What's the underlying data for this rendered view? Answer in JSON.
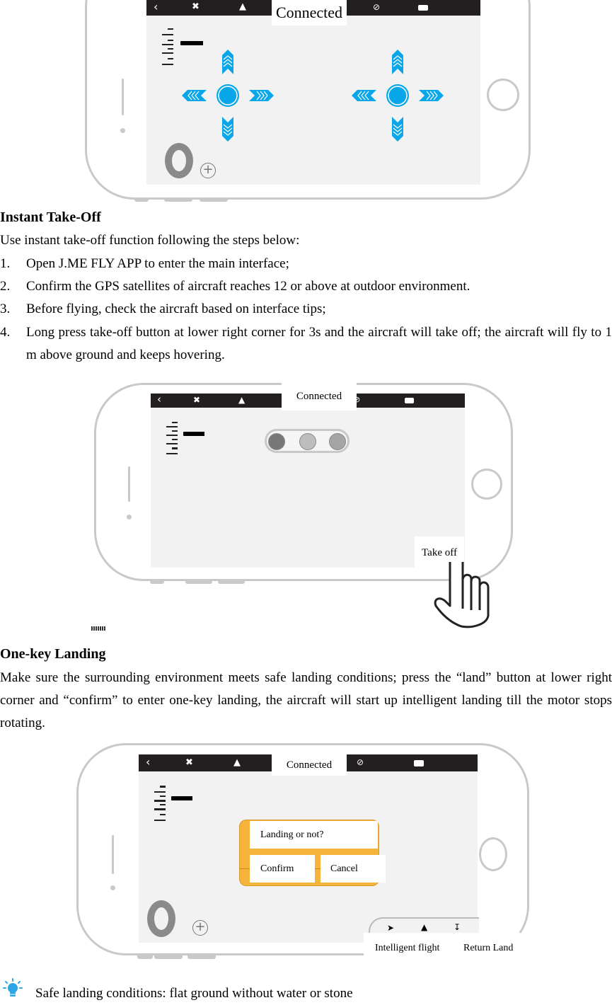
{
  "app_screens": [
    {
      "id": "main-interface",
      "status_label": "Connected",
      "topbar_icons": [
        "back-icon",
        "satellite-icon",
        "takeoff-icon",
        "compass-icon",
        "battery-icon"
      ]
    },
    {
      "id": "takeoff-interface",
      "status_label": "Connected",
      "topbar_icons": [
        "back-icon",
        "satellite-icon",
        "takeoff-icon",
        "compass-icon",
        "battery-icon"
      ],
      "indicator_lights": [
        "#777777",
        "#bdbdbd",
        "#a5a5a5"
      ],
      "takeoff_label": "Take off"
    },
    {
      "id": "landing-interface",
      "status_label": "Connected",
      "topbar_icons": [
        "back-icon",
        "satellite-icon",
        "takeoff-icon",
        "compass-icon",
        "battery-icon"
      ],
      "dialog": {
        "question": "Landing or not?",
        "confirm_label": "Confirm",
        "cancel_label": "Cancel",
        "color": "#f6b33c"
      },
      "mode_labels": {
        "intelligent_flight": "Intelligent flight",
        "return_land": "Return Land"
      }
    }
  ],
  "sections": {
    "takeoff": {
      "heading": "Instant Take-Off",
      "intro": "Use instant take-off function following the steps below:",
      "steps": [
        {
          "num": "1.",
          "text": "Open J.ME FLY APP to enter the main interface;"
        },
        {
          "num": "2.",
          "text": "Confirm the GPS satellites of aircraft reaches 12 or above at outdoor environment."
        },
        {
          "num": "3.",
          "text": "Before flying, check the aircraft based on interface tips;"
        },
        {
          "num": "4.",
          "text": "Long press take-off button at lower right corner for 3s and the aircraft will take off; the aircraft will fly to 1 m above ground and keeps hovering."
        }
      ]
    },
    "landing": {
      "heading": "One-key Landing",
      "body": "Make sure the surrounding environment meets safe landing conditions; press the “land” button at lower right corner and “confirm” to enter one-key landing, the aircraft will start up intelligent landing till the motor stops rotating."
    },
    "tip": {
      "icon": "lightbulb-icon",
      "text": "Safe landing conditions: flat ground without water or stone"
    }
  },
  "colors": {
    "joystick_blue": "#0aa6ea",
    "topbar": "#231f20",
    "screen_bg": "#f2f2f2"
  }
}
